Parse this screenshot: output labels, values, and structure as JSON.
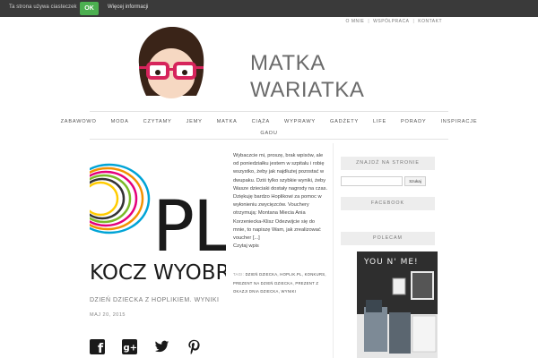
{
  "cookie": {
    "text": "Ta strona używa ciasteczek",
    "ok_label": "OK",
    "more_label": "Więcej informacji"
  },
  "top_links": [
    "O mnie",
    "Współpraca",
    "Kontakt"
  ],
  "site_title": "MATKA WARIATKA",
  "site_title_line1": "MATKA",
  "site_title_line2": "WARIATKA",
  "nav": {
    "row1": [
      "Zabawowo",
      "Moda",
      "Czytamy",
      "Jemy",
      "Matka",
      "Ciąża",
      "Wyprawy",
      "Gadżety",
      "Life",
      "Porady",
      "Inspiracje"
    ],
    "row2": [
      "Gadu"
    ]
  },
  "post": {
    "image_text_top": "OPL",
    "image_text_bottom": "KOCZ WYOBR",
    "excerpt": "Wybaczcie mi, proszę, brak wpisów, ale od poniedziałku jestem w szpitalu i robię wszystko, żeby jak najdłużej pozostać w dwupaku. Dziś tylko szybkie wyniki, żeby Wasze dzieciaki dostały nagrody na czas. Dziękuję bardzo Hoplikowi za pomoc w wyłonieniu zwycięzców. Vouchery otrzymują: Montana Miecia Ania Korzeniecka-Klisz Odezwijcie się do mnie, to napiszę Wam, jak zrealizować voucher [...]",
    "read_more": "Czytaj wpis",
    "meta_label": "TAGI:",
    "tags": "DZIEŃ DZIECKA, HOPLIK.PL, KONKURS, PREZENT NA DZIEŃ DZIECKA, PREZENT Z OKAZJI DNIA DZIECKA, WYNIKI",
    "title": "Dzień Dziecka z Hoplikiem. Wyniki",
    "date": "Maj 20, 2015"
  },
  "social": [
    "facebook-icon",
    "google-plus-icon",
    "twitter-icon",
    "pinterest-icon"
  ],
  "sidebar": {
    "search_title": "Znajdź na stronie",
    "search_placeholder": "",
    "search_button": "Szukaj",
    "facebook_title": "Facebook",
    "polecam_title": "Polecam",
    "polecam_image_text": "YOU N' ME!"
  },
  "colors": {
    "cookie_bg": "#3a3a3a",
    "ok_green": "#4caf50",
    "glasses_pink": "#d6245c",
    "widget_bg": "#ededed"
  }
}
